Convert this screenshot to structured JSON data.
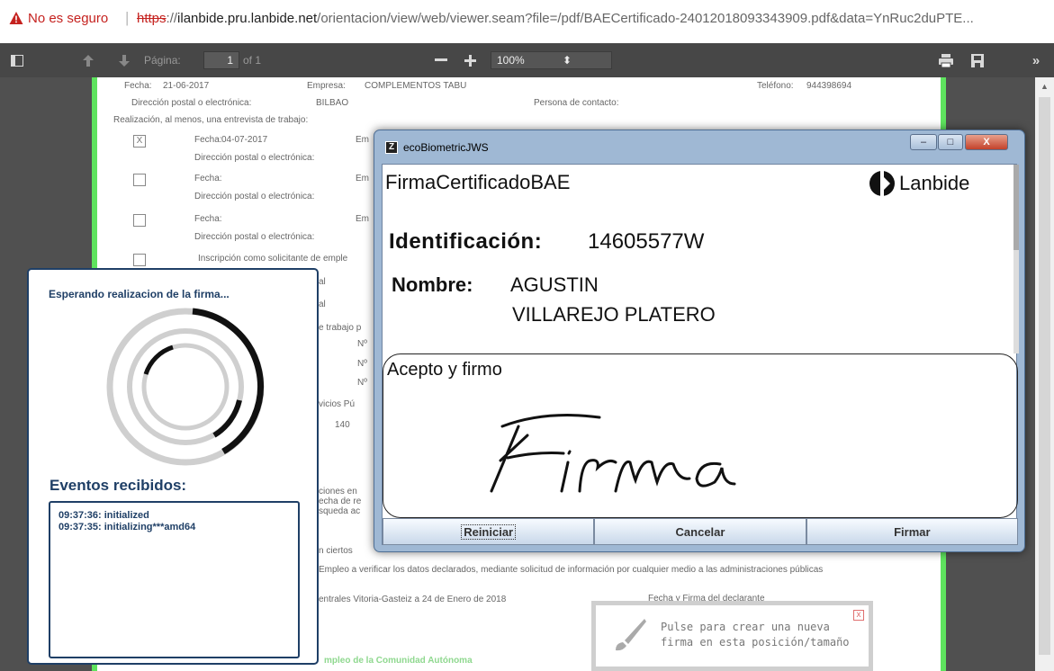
{
  "browser": {
    "security_warning": "No es seguro",
    "separator": "|",
    "url_scheme": "https",
    "url_scheme_sep": "://",
    "url_host": "ilanbide.pru.lanbide.net",
    "url_rest": "/orientacion/view/web/viewer.seam?file=/pdf/BAECertificado-24012018093343909.pdf&data=YnRuc2duPTE..."
  },
  "pdf_toolbar": {
    "page_label": "Página:",
    "page_number": "1",
    "page_total": "of 1",
    "zoom": "100%",
    "icons": [
      "sidebar-toggle-icon",
      "arrow-up-icon",
      "arrow-down-icon",
      "zoom-out-icon",
      "zoom-in-icon",
      "print-icon",
      "download-icon",
      "more-icon"
    ]
  },
  "pdf_page": {
    "fecha_label": "Fecha:",
    "fecha_value": "21-06-2017",
    "empresa_label": "Empresa:",
    "empresa_value": "COMPLEMENTOS TABU",
    "telefono_label": "Teléfono:",
    "telefono_value": "944398694",
    "direccion_label": "Dirección postal o electrónica:",
    "direccion_value": "BILBAO",
    "persona_contacto": "Persona de contacto:",
    "realizacion": "Realización, al menos, una entrevista de trabajo:",
    "checkbox_checked_mark": "X",
    "fecha2_value": "04-07-2017",
    "em_fragment": "Em",
    "inscripcion": "Inscripción como solicitante de emple",
    "al_fragment": "al",
    "trabajo_fragment": "e trabajo p",
    "n_fragment": "Nº",
    "servicios_fragment": "vicios Pú",
    "num_140": "140",
    "ciones_fragment": "ciones en",
    "echa_fragment": "echa de re",
    "squeda_fragment": "squeda ac",
    "ciertos_fragment": "n ciertos",
    "verificar_text": "Empleo a verificar los datos declarados, mediante solicitud de información por cualquier medio a las administraciones públicas",
    "vitoria_text": "entrales Vitoria-Gasteiz a 24 de Enero de 2018",
    "firma_declarante": "Fecha y Firma del declarante",
    "comunidad_text": "mpleo de la Comunidad Autónoma"
  },
  "signature_panel": {
    "title": "Esperando realizacion de la firma...",
    "events_title": "Eventos recibidos:",
    "events": [
      "09:37:36: initialized",
      "09:37:35: initializing***amd64"
    ]
  },
  "dialog": {
    "window_title": "ecoBiometricJWS",
    "app_icon_letter": "Z",
    "minimize": "–",
    "maximize": "□",
    "close": "X",
    "document_name": "FirmaCertificadoBAE",
    "brand_name": "Lanbide",
    "id_label": "Identificación:",
    "id_value": "14605577W",
    "name_label": "Nombre:",
    "name_line1": "AGUSTIN",
    "name_line2": "VILLAREJO PLATERO",
    "signature_label": "Acepto y firmo",
    "handwritten_signature": "Firma",
    "buttons": {
      "reset": "Reiniciar",
      "cancel": "Cancelar",
      "sign": "Firmar"
    }
  },
  "hint": {
    "line1": "Pulse para crear una nueva",
    "line2": "firma en esta posición/tamaño",
    "close": "x"
  },
  "colors": {
    "warning_red": "#c5221f",
    "panel_navy": "#1f3f66",
    "page_border_green": "#5ee35e",
    "toolbar_gray": "#474747"
  }
}
